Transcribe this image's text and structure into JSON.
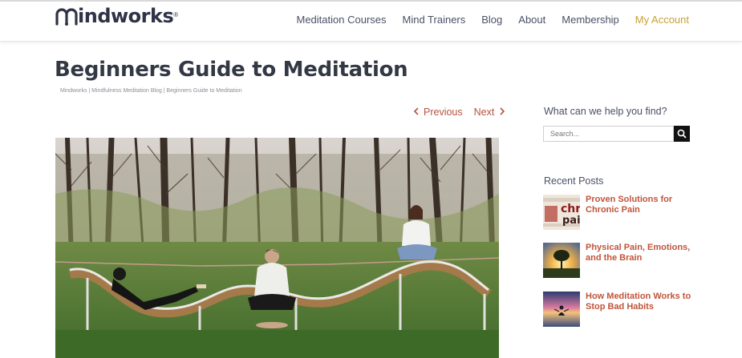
{
  "brand": {
    "logo_text": "indworks",
    "logo_reg": "®"
  },
  "nav": {
    "items": [
      "Meditation Courses",
      "Mind Trainers",
      "Blog",
      "About",
      "Membership"
    ],
    "account": "My Account"
  },
  "page": {
    "title": "Beginners Guide to Meditation",
    "breadcrumb": "Mindworks | Mindfulness Meditation Blog | Beginners Guide to Meditation"
  },
  "post_nav": {
    "previous": "Previous",
    "next": "Next"
  },
  "sidebar": {
    "help_heading": "What can we help you find?",
    "search_placeholder": "Search...",
    "recent_heading": "Recent Posts",
    "recent_posts": [
      {
        "title": "Proven Solutions for Chronic Pain",
        "thumb_text": "chro pai"
      },
      {
        "title": "Physical Pain, Emotions, and the Brain"
      },
      {
        "title": "How Meditation Works to Stop Bad Habits"
      }
    ]
  },
  "colors": {
    "accent": "#b5533c",
    "account": "#c8a034",
    "title": "#333845",
    "search_button": "#111111"
  },
  "icons": [
    "search-icon",
    "chevron-left-icon",
    "chevron-right-icon"
  ]
}
